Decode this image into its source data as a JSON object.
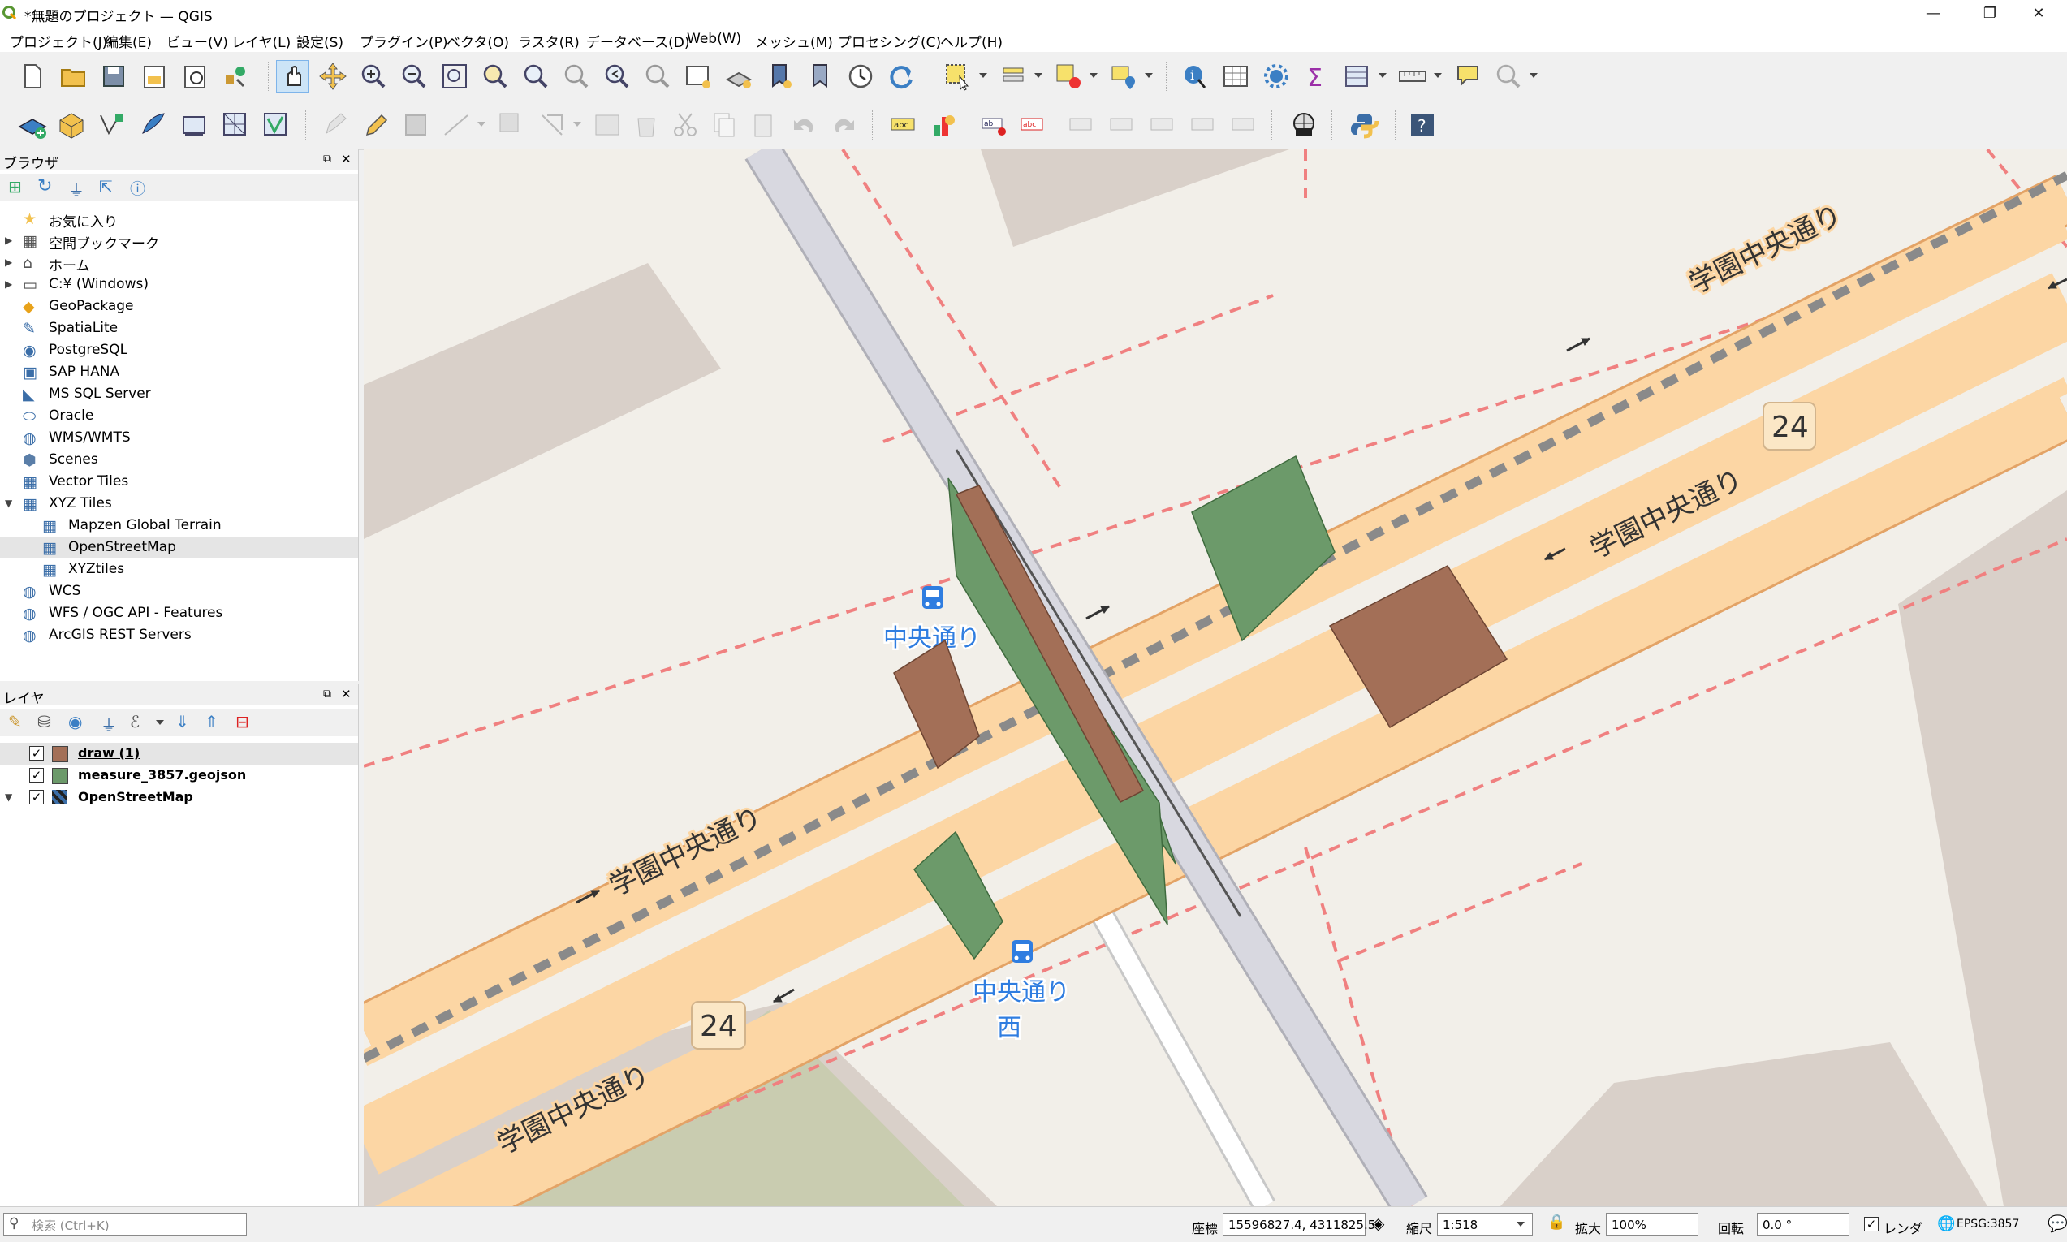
{
  "window": {
    "title": "*無題のプロジェクト — QGIS"
  },
  "menus": [
    "プロジェクト(J)",
    "編集(E)",
    "ビュー(V)",
    "レイヤ(L)",
    "設定(S)",
    "プラグイン(P)",
    "ベクタ(O)",
    "ラスタ(R)",
    "データベース(D)",
    "Web(W)",
    "メッシュ(M)",
    "プロセシング(C)",
    "ヘルプ(H)"
  ],
  "browser": {
    "title": "ブラウザ",
    "items": [
      {
        "label": "お気に入り",
        "icon": "star-icon",
        "expand": ""
      },
      {
        "label": "空間ブックマーク",
        "icon": "bookmark-icon",
        "expand": "▶"
      },
      {
        "label": "ホーム",
        "icon": "home-icon",
        "expand": "▶"
      },
      {
        "label": "C:¥ (Windows)",
        "icon": "folder-icon",
        "expand": "▶"
      },
      {
        "label": "GeoPackage",
        "icon": "geopackage-icon",
        "expand": ""
      },
      {
        "label": "SpatiaLite",
        "icon": "spatialite-icon",
        "expand": ""
      },
      {
        "label": "PostgreSQL",
        "icon": "postgresql-icon",
        "expand": ""
      },
      {
        "label": "SAP HANA",
        "icon": "hana-icon",
        "expand": ""
      },
      {
        "label": "MS SQL Server",
        "icon": "mssql-icon",
        "expand": ""
      },
      {
        "label": "Oracle",
        "icon": "oracle-icon",
        "expand": ""
      },
      {
        "label": "WMS/WMTS",
        "icon": "globe-icon",
        "expand": ""
      },
      {
        "label": "Scenes",
        "icon": "scenes-icon",
        "expand": ""
      },
      {
        "label": "Vector Tiles",
        "icon": "vector-tiles-icon",
        "expand": ""
      },
      {
        "label": "XYZ Tiles",
        "icon": "xyz-tiles-icon",
        "expand": "▼"
      },
      {
        "label": "Mapzen Global Terrain",
        "icon": "tile-icon",
        "expand": "",
        "child": true
      },
      {
        "label": "OpenStreetMap",
        "icon": "tile-icon",
        "expand": "",
        "child": true,
        "selected": true
      },
      {
        "label": "XYZtiles",
        "icon": "tile-icon",
        "expand": "",
        "child": true
      },
      {
        "label": "WCS",
        "icon": "globe-icon",
        "expand": ""
      },
      {
        "label": "WFS / OGC API - Features",
        "icon": "wfs-icon",
        "expand": ""
      },
      {
        "label": "ArcGIS REST Servers",
        "icon": "arcgis-icon",
        "expand": ""
      }
    ]
  },
  "layers": {
    "title": "レイヤ",
    "items": [
      {
        "label": "draw (1)",
        "color": "#a36f57",
        "checked": "✓",
        "expand": ""
      },
      {
        "label": "measure_3857.geojson",
        "color": "#6c9a6a",
        "checked": "✓",
        "expand": ""
      },
      {
        "label": "OpenStreetMap",
        "color": "",
        "checked": "✓",
        "expand": "▼"
      }
    ]
  },
  "map": {
    "road_labels": [
      "学園中央通り",
      "学園中央通り",
      "学園中央通り",
      "学園中央通り"
    ],
    "route_shields": [
      "24",
      "24"
    ],
    "bus_stops": [
      "中央通り",
      "中央通り 西"
    ],
    "colors": {
      "road": "#fcd6a4",
      "road_edge": "#e3a366",
      "rail": "#d8d8e0",
      "boundary": "#f08080",
      "draw_fill": "#a36f57",
      "measure_fill": "#6c9a6a"
    }
  },
  "status": {
    "search_placeholder": "検索 (Ctrl+K)",
    "coord_label": "座標",
    "coord_value": "15596827.4, 4311825.5",
    "scale_label": "縮尺",
    "scale_value": "1:518",
    "magnify_label": "拡大",
    "magnify_value": "100%",
    "rotation_label": "回転",
    "rotation_value": "0.0 °",
    "render_label": "レンダ",
    "crs": "EPSG:3857"
  }
}
